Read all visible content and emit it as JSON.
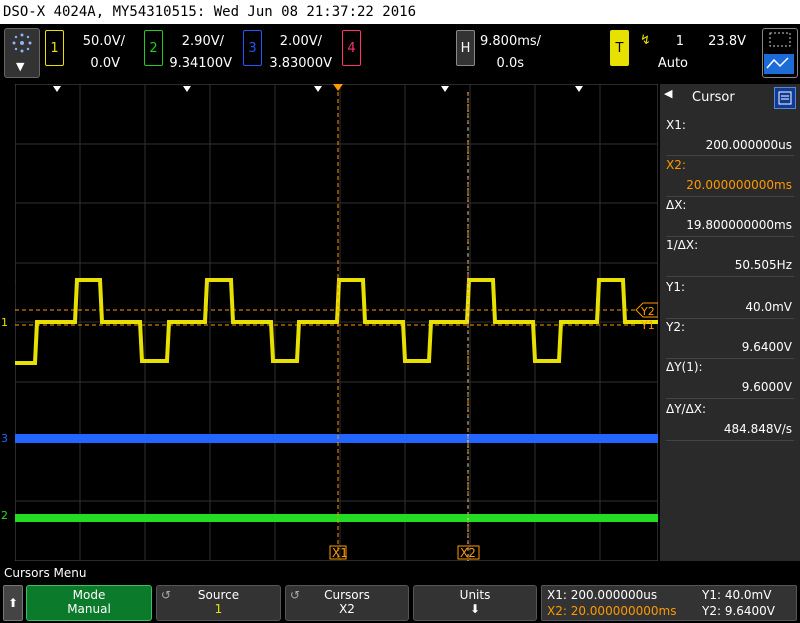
{
  "title": "DSO-X 4024A, MY54310515: Wed Jun 08 21:37:22 2016",
  "channels": [
    {
      "num": "1",
      "scale": "50.0V/",
      "offset": "0.0V",
      "color": "#e8e000"
    },
    {
      "num": "2",
      "scale": "2.90V/",
      "offset": "9.34100V",
      "color": "#22cc22"
    },
    {
      "num": "3",
      "scale": "2.00V/",
      "offset": "3.83000V",
      "color": "#2255ff"
    },
    {
      "num": "4",
      "scale": "",
      "offset": "",
      "color": "#ff3366"
    }
  ],
  "horizontal": {
    "label": "H",
    "scale": "9.800ms/",
    "delay": "0.0s"
  },
  "trigger": {
    "label": "T",
    "source": "1",
    "level": "23.8V",
    "mode": "Auto"
  },
  "cursor_panel": {
    "title": "Cursor",
    "rows": [
      {
        "label": "X1:",
        "value": "200.000000us"
      },
      {
        "label": "X2:",
        "value": "20.000000000ms"
      },
      {
        "label": "ΔX:",
        "value": "19.800000000ms"
      },
      {
        "label": "1/ΔX:",
        "value": "50.505Hz"
      },
      {
        "label": "Y1:",
        "value": "40.0mV"
      },
      {
        "label": "Y2:",
        "value": "9.6400V"
      },
      {
        "label": "ΔY(1):",
        "value": "9.6000V"
      },
      {
        "label": "ΔY/ΔX:",
        "value": "484.848V/s"
      }
    ]
  },
  "markers": {
    "x1": "X1",
    "x2": "X2",
    "y1": "Y1",
    "y2": "Y2",
    "t": "T",
    "ch1": "1",
    "ch2": "2",
    "ch3": "3"
  },
  "menu": {
    "title": "Cursors Menu",
    "keys": [
      {
        "top": "Mode",
        "bottom": "Manual",
        "active": true
      },
      {
        "top": "Source",
        "bottom": "1",
        "active": false
      },
      {
        "top": "Cursors",
        "bottom": "X2",
        "active": false
      },
      {
        "top": "Units",
        "bottom": "",
        "active": false
      }
    ],
    "readout": {
      "x1": "X1: 200.000000us",
      "x2": "X2: 20.000000000ms",
      "y1": "Y1: 40.0mV",
      "y2": "Y2: 9.6400V"
    }
  }
}
